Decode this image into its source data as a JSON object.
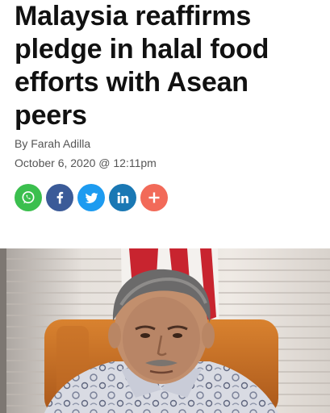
{
  "article": {
    "title_lines": [
      "Malaysia reaffirms",
      "pledge in halal food",
      "efforts with Asean",
      "peers"
    ],
    "byline": "By Farah Adilla",
    "date": "October 6, 2020 @ 12:11pm"
  },
  "share": {
    "buttons": [
      {
        "name": "whatsapp",
        "icon": "whatsapp-icon",
        "color": "#3bbf4e"
      },
      {
        "name": "facebook",
        "icon": "facebook-icon",
        "color": "#3b5b98"
      },
      {
        "name": "twitter",
        "icon": "twitter-icon",
        "color": "#1d9bf0"
      },
      {
        "name": "linkedin",
        "icon": "linkedin-icon",
        "color": "#1a78b4"
      },
      {
        "name": "more",
        "icon": "plus-icon",
        "color": "#f26a59"
      }
    ]
  },
  "colors": {
    "headline": "#111111",
    "meta_text": "#555555"
  }
}
